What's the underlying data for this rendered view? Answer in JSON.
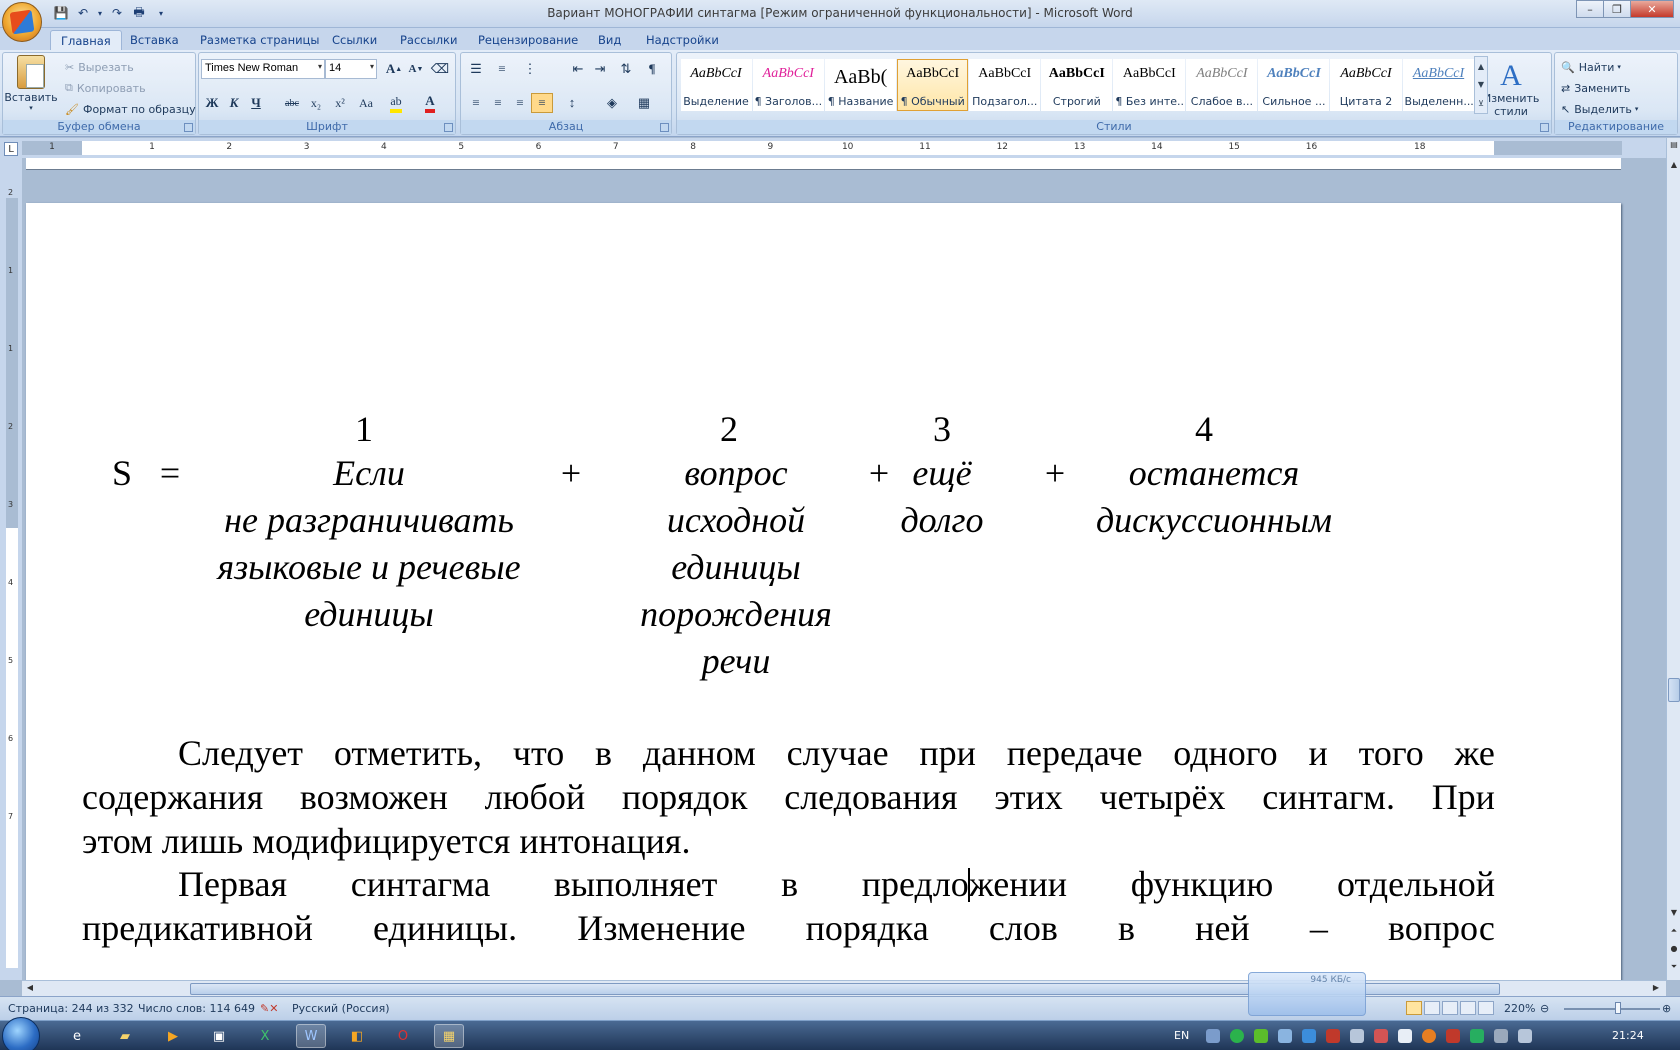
{
  "window": {
    "title": "Вариант МОНОГРАФИИ синтагма [Режим ограниченной функциональности] - Microsoft Word",
    "minimize": "–",
    "maximize": "❐",
    "close": "✕"
  },
  "tabs": [
    "Главная",
    "Вставка",
    "Разметка страницы",
    "Ссылки",
    "Рассылки",
    "Рецензирование",
    "Вид",
    "Надстройки"
  ],
  "clipboard": {
    "paste": "Вставить",
    "cut": "Вырезать",
    "copy": "Копировать",
    "format_painter": "Формат по образцу",
    "label": "Буфер обмена"
  },
  "font": {
    "name": "Times New Roman",
    "size": "14",
    "label": "Шрифт",
    "grow": "A",
    "shrink": "A",
    "bold": "Ж",
    "italic": "К",
    "underline": "Ч",
    "strike": "abc",
    "subscript": "x₂",
    "superscript": "x²",
    "case": "Aa",
    "color_letter": "A",
    "highlight_color": "#ffe600",
    "font_color": "#e02020"
  },
  "paragraph": {
    "label": "Абзац",
    "pilcrow": "¶"
  },
  "styles": {
    "label": "Стили",
    "items": [
      {
        "sample": "AaBbCcI",
        "name": "Выделение",
        "color": "#000000",
        "italic": true
      },
      {
        "sample": "AaBbCcI",
        "name": "¶ Заголов...",
        "color": "#e0209a",
        "italic": true
      },
      {
        "sample": "AaBb(",
        "name": "¶ Название",
        "color": "#000000",
        "big": true
      },
      {
        "sample": "AaBbCcI",
        "name": "¶ Обычный",
        "color": "#000000",
        "selected": true
      },
      {
        "sample": "AaBbCcI",
        "name": "Подзагол...",
        "color": "#000000"
      },
      {
        "sample": "AaBbCcI",
        "name": "Строгий",
        "color": "#000000",
        "bold": true
      },
      {
        "sample": "AaBbCcI",
        "name": "¶ Без инте...",
        "color": "#000000"
      },
      {
        "sample": "AaBbCcI",
        "name": "Слабое в...",
        "color": "#7f7f7f",
        "italic": true
      },
      {
        "sample": "AaBbCcI",
        "name": "Сильное ...",
        "color": "#4f81bd",
        "italic": true,
        "bold": true
      },
      {
        "sample": "AaBbCcI",
        "name": "Цитата 2",
        "color": "#000000",
        "italic": true
      },
      {
        "sample": "AaBbCcI",
        "name": "Выделенн...",
        "color": "#4f81bd",
        "italic": true,
        "underline": true
      }
    ],
    "change": "Изменить стили"
  },
  "editing": {
    "label": "Редактирование",
    "find": "Найти",
    "replace": "Заменить",
    "select": "Выделить"
  },
  "ruler": {
    "numbers": [
      "1",
      "1",
      "2",
      "3",
      "4",
      "5",
      "6",
      "7",
      "8",
      "9",
      "10",
      "11",
      "12",
      "13",
      "14",
      "15",
      "16",
      "18"
    ],
    "vnumbers": [
      "2",
      "1",
      "1",
      "2",
      "3",
      "4",
      "5",
      "6",
      "7"
    ]
  },
  "document": {
    "formula": {
      "lhs": "S",
      "eq": "=",
      "plus": "+",
      "numbers": [
        "1",
        "2",
        "3",
        "4"
      ],
      "col1": [
        "Если",
        "не разграничивать",
        "языковые и речевые",
        "единицы"
      ],
      "col2": [
        "вопрос",
        "исходной",
        "единицы",
        "порождения",
        "речи"
      ],
      "col3": [
        "ещё",
        "долго"
      ],
      "col4": [
        "останется",
        "дискуссионным"
      ]
    },
    "para1": {
      "line1_words": [
        "Следует",
        "отметить,",
        "что",
        "в",
        "данном",
        "случае",
        "при",
        "передаче",
        "одного",
        "и",
        "того",
        "же"
      ],
      "line2_words": [
        "содержания",
        "возможен",
        "любой",
        "порядок",
        "следования",
        "этих",
        "четырёх",
        "синтагм.",
        "При"
      ],
      "line3": "этом лишь модифицируется интонация."
    },
    "para2": {
      "line1_words": [
        "Первая",
        "синтагма",
        "выполняет",
        "в",
        "предло",
        "жении",
        "функцию",
        "отдельной"
      ],
      "line2_words": [
        "предикативной",
        "единицы.",
        "Изменение",
        "порядка",
        "слов",
        "в",
        "ней",
        "–",
        "вопрос"
      ]
    }
  },
  "status": {
    "page": "Страница: 244 из 332",
    "words": "Число слов: 114 649",
    "language": "Русский (Россия)",
    "zoom": "220%",
    "net_rate": "945 КБ/с"
  },
  "taskbar": {
    "lang": "EN",
    "time": "21:24"
  }
}
